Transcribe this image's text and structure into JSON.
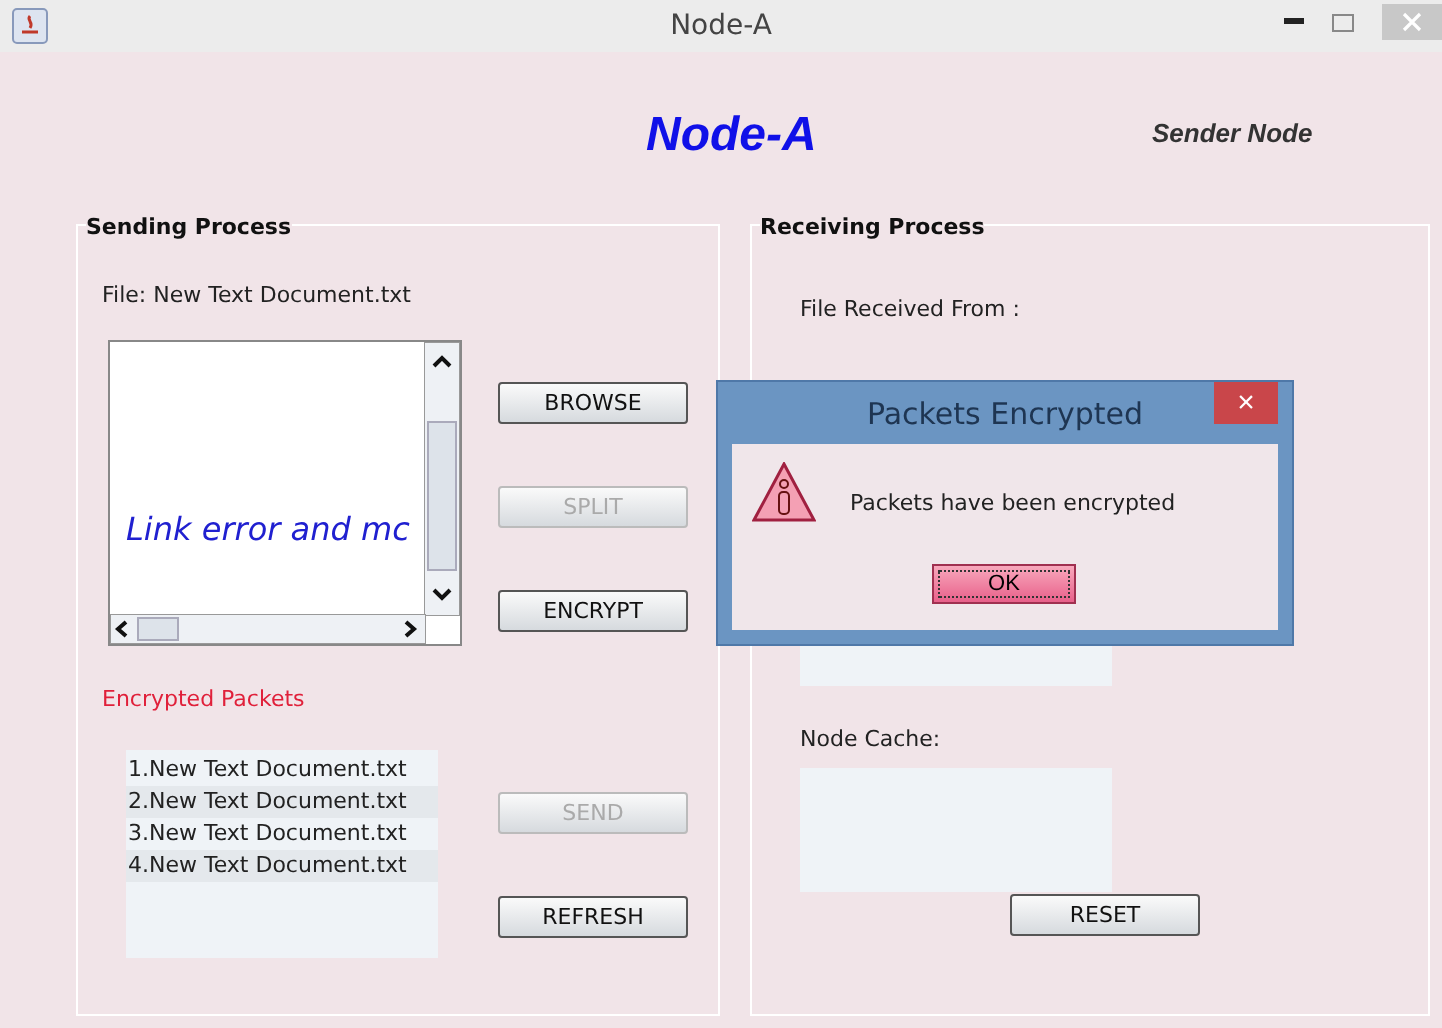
{
  "window": {
    "title": "Node-A"
  },
  "header": {
    "title": "Node-A",
    "subtitle": "Sender Node"
  },
  "sending": {
    "legend": "Sending Process",
    "file_label": "File: New Text Document.txt",
    "preview_text": "Link error and mc",
    "buttons": [
      {
        "label": "BROWSE",
        "disabled": false
      },
      {
        "label": "SPLIT",
        "disabled": true
      },
      {
        "label": "ENCRYPT",
        "disabled": false
      }
    ],
    "packets_label": "Encrypted Packets",
    "packets": [
      "1.New Text Document.txt",
      "2.New Text Document.txt",
      "3.New Text Document.txt",
      "4.New Text Document.txt"
    ],
    "bottom_buttons": [
      {
        "label": "SEND",
        "disabled": true
      },
      {
        "label": "REFRESH",
        "disabled": false
      }
    ]
  },
  "receiving": {
    "legend": "Receiving Process",
    "from_label": "File Received From :",
    "cache_label": "Node Cache:",
    "reset": "RESET"
  },
  "dialog": {
    "title": "Packets Encrypted",
    "close": "×",
    "message": "Packets have been encrypted",
    "ok": "OK"
  }
}
